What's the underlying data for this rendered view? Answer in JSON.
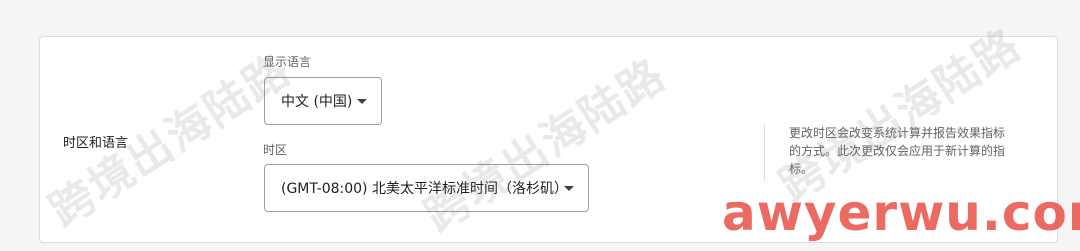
{
  "settings": {
    "section_title": "时区和语言",
    "language": {
      "label": "显示语言",
      "value": "中文 (中国)"
    },
    "timezone": {
      "label": "时区",
      "value": "(GMT-08:00) 北美太平洋标准时间（洛杉矶）"
    },
    "help_text": "更改时区会改变系统计算并报告效果指标的方式。此次更改仅会应用于新计算的指标。"
  },
  "watermark": {
    "text": "跨境出海陆路",
    "brand": "awyerwu.com"
  },
  "colors": {
    "card_border": "#dadce0",
    "select_border": "#9aa0a6",
    "label_text": "#5f6368",
    "brand_watermark": "#e85046"
  }
}
